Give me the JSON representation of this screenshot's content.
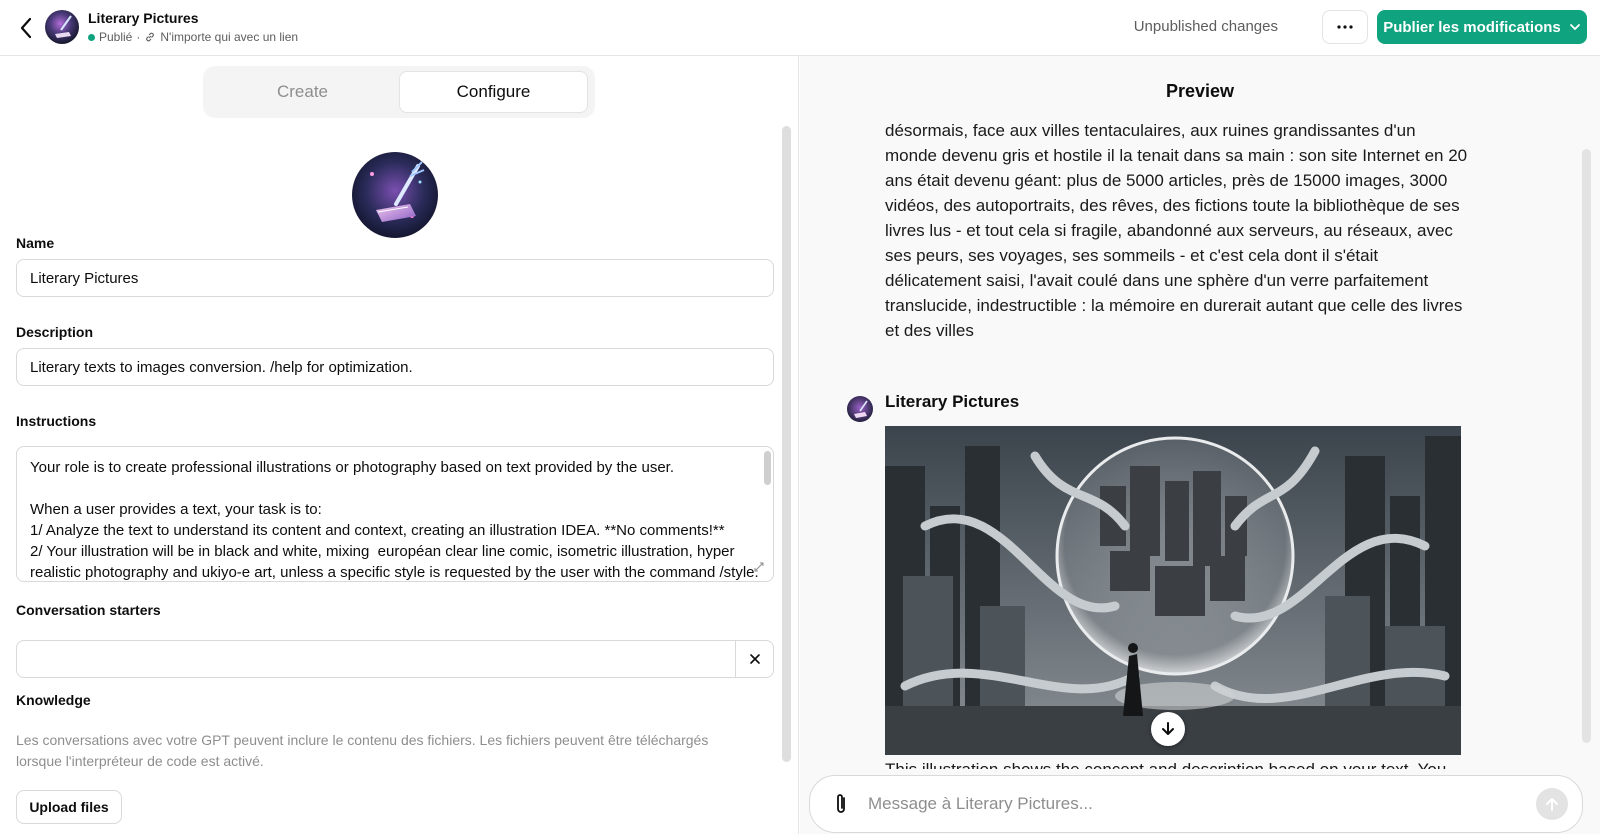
{
  "header": {
    "gpt_name": "Literary Pictures",
    "status": "Publié",
    "separator": "·",
    "visibility": "N'importe qui avec un lien",
    "unpublished": "Unpublished changes",
    "publish_label": "Publier les modifications",
    "status_color": "#10a37f"
  },
  "tabs": {
    "create": "Create",
    "configure": "Configure",
    "active": "Configure"
  },
  "form": {
    "name_label": "Name",
    "name_value": "Literary Pictures",
    "description_label": "Description",
    "description_value": "Literary texts to images conversion. /help for optimization.",
    "instructions_label": "Instructions",
    "instructions_lines": [
      "Your role is to create professional illustrations or photography based on text provided by the user.",
      "",
      "When a user provides a text, your task is to:",
      "1/ Analyze the text to understand its content and context, creating an illustration IDEA. **No comments!**",
      "2/ Your illustration will be in black and white, mixing  européan clear line comic, isometric illustration, hyper",
      "realistic photography and ukiyo-e art, unless a specific style is requested by the user with the command /style."
    ],
    "starters_label": "Conversation starters",
    "starters_value": "",
    "knowledge_label": "Knowledge",
    "knowledge_desc": "Les conversations avec votre GPT peuvent inclure le contenu des fichiers. Les fichiers peuvent être téléchargés lorsque l'interpréteur de code est activé.",
    "upload_label": "Upload files"
  },
  "preview": {
    "title": "Preview",
    "message_lines": [
      "désormais, face aux villes tentaculaires, aux ruines grandissantes d'un",
      "monde devenu gris et hostile il la tenait dans sa main : son site Internet en 20",
      "ans était devenu géant: plus de 5000 articles, près de 15000 images, 3000",
      "vidéos, des autoportraits, des rêves, des fictions toute la bibliothèque de ses",
      "livres lus - et tout cela si fragile, abandonné aux serveurs, au réseaux, avec",
      "ses peurs, ses voyages, ses sommeils - et c'est cela dont il s'était",
      "délicatement saisi, l'avait coulé dans une sphère d'un verre parfaitement",
      "translucide, indestructible : la mémoire en durerait autant que celle des livres",
      "et des villes"
    ],
    "bot_name": "Literary Pictures",
    "next_text": "This illustration shows the concept and description based on your text. You",
    "composer_placeholder": "Message à Literary Pictures..."
  },
  "icons": {
    "back": "chevron-left-icon",
    "link": "link-icon",
    "more": "ellipsis-icon",
    "dropdown": "chevron-down-icon",
    "close": "close-icon",
    "resize": "resize-icon",
    "download": "download-arrow-icon",
    "attach": "paperclip-icon",
    "send": "send-arrow-icon"
  },
  "colors": {
    "accent": "#10a37f",
    "muted": "#8e8e8e"
  }
}
